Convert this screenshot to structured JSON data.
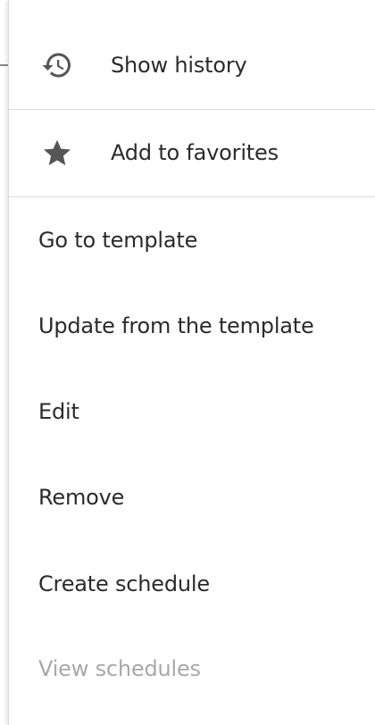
{
  "menu": {
    "items_with_icons": [
      {
        "label": "Show history",
        "icon": "history-icon"
      },
      {
        "label": "Add to favorites",
        "icon": "star-icon"
      }
    ],
    "items": [
      {
        "label": "Go to template",
        "disabled": false
      },
      {
        "label": "Update from the template",
        "disabled": false
      },
      {
        "label": "Edit",
        "disabled": false
      },
      {
        "label": "Remove",
        "disabled": false
      },
      {
        "label": "Create schedule",
        "disabled": false
      },
      {
        "label": "View schedules",
        "disabled": true
      }
    ]
  },
  "colors": {
    "text": "#2b2b2b",
    "disabled_text": "#a8a8a8",
    "icon": "#555555",
    "divider": "#dddddd"
  }
}
